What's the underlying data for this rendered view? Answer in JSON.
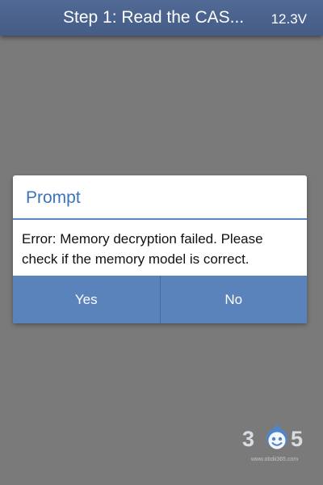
{
  "header": {
    "title": "Step 1: Read the CAS...",
    "voltage": "12.3V"
  },
  "dialog": {
    "title": "Prompt",
    "message": "Error: Memory decryption failed. Please check if the memory model is correct.",
    "buttons": {
      "yes": "Yes",
      "no": "No"
    }
  },
  "watermark": {
    "digit_left": "3",
    "digit_right": "5",
    "url": "www.obdii365.com"
  },
  "colors": {
    "header": "#4a628c",
    "overlay": "#7a7a7a",
    "accent": "#3d74b8",
    "button_bar": "#5a82bb"
  }
}
